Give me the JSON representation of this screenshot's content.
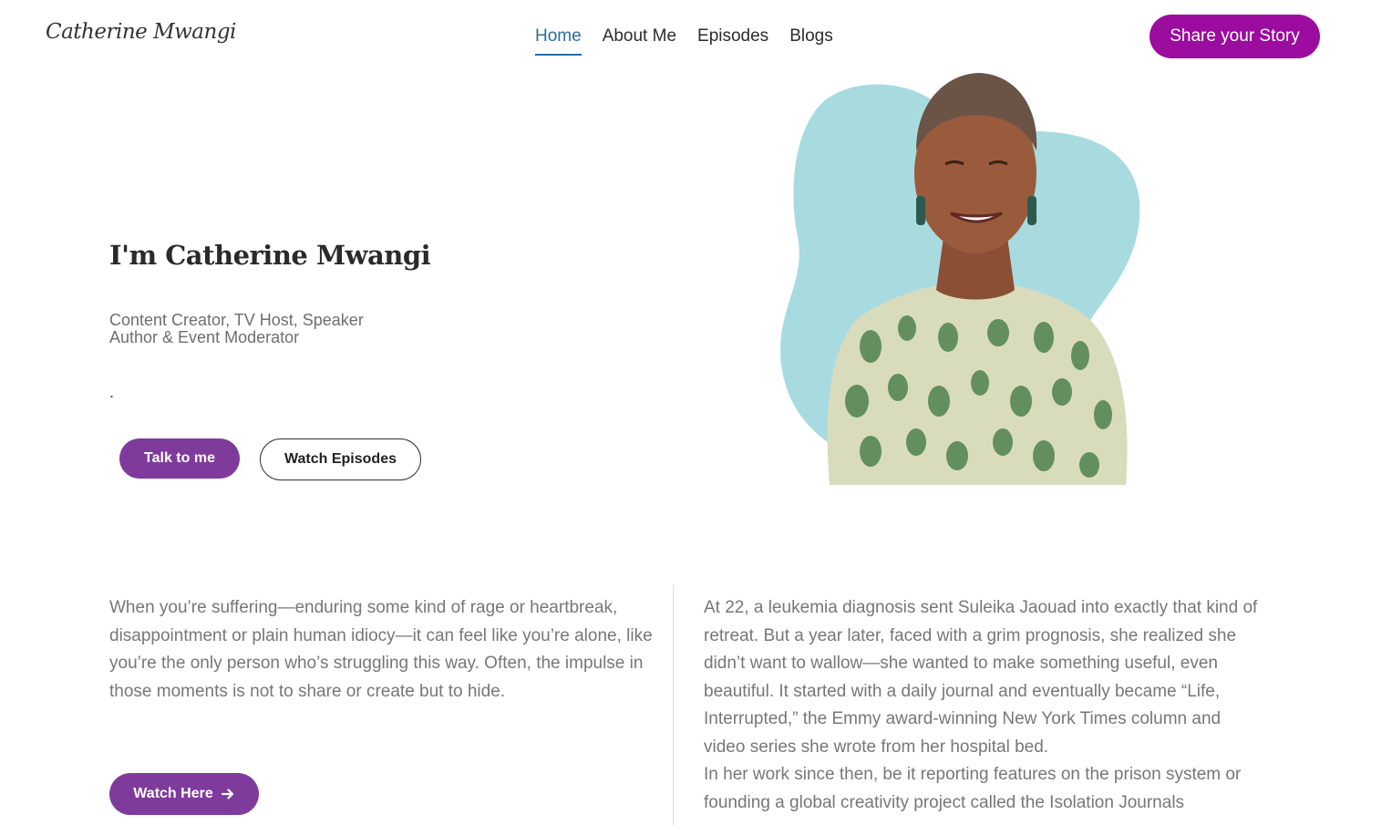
{
  "header": {
    "logo_text": "Catherine Mwangi",
    "nav": [
      {
        "label": "Home",
        "active": true
      },
      {
        "label": "About Me",
        "active": false
      },
      {
        "label": "Episodes",
        "active": false
      },
      {
        "label": "Blogs",
        "active": false
      }
    ],
    "cta_label": "Share your Story"
  },
  "hero": {
    "title": "I'm Catherine Mwangi",
    "roles_line1": "Content Creator, TV Host, Speaker",
    "roles_line2": "Author & Event Moderator",
    "dot": ".",
    "primary_button": "Talk to me",
    "secondary_button": "Watch Episodes"
  },
  "intro": {
    "left_paragraph": "When you’re suffering—enduring some kind of rage or heartbreak, disappointment or plain human idiocy—it can feel like you’re alone, like you’re the only person who’s struggling this way. Often, the impulse in those moments is not to share or create but to hide.",
    "watch_button": "Watch Here",
    "right_paragraph_1": "At 22, a leukemia diagnosis sent Suleika Jaouad into exactly that kind of retreat. But a year later, faced with a grim prognosis, she realized she didn’t want to wallow—she wanted to make something useful, even beautiful. It started with a daily journal and eventually became “Life, Interrupted,” the Emmy award-winning New York Times column and video series she wrote from her hospital bed.",
    "right_paragraph_2": "In her work since then, be it reporting features on the prison system or founding a global creativity project called the Isolation Journals"
  },
  "colors": {
    "cta_purple": "#9b0c9f",
    "button_purple": "#7f3b9c",
    "nav_active": "#2a6ca3",
    "blob": "#a8dbe0",
    "body_text": "#777777"
  },
  "icons": {
    "watch_here": "arrow-right-icon"
  }
}
